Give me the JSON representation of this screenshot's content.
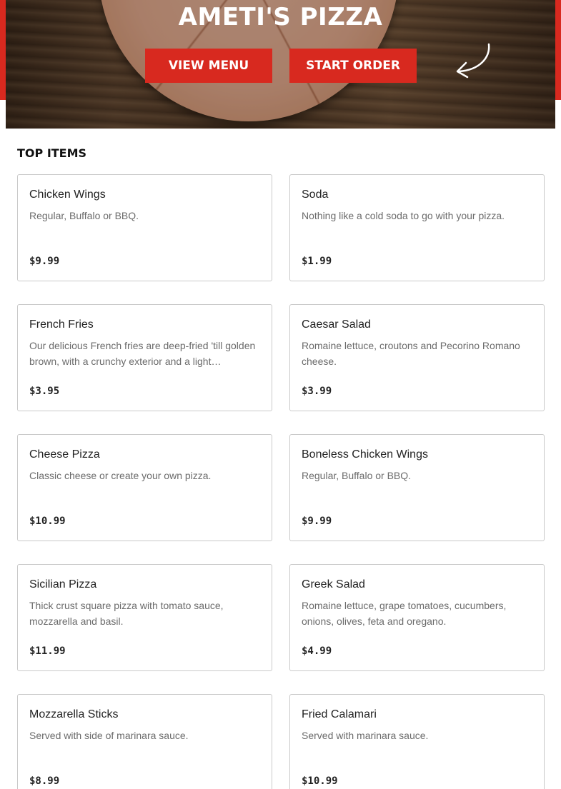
{
  "hero": {
    "title": "AMETI'S PIZZA",
    "view_menu_label": "VIEW MENU",
    "start_order_label": "START ORDER",
    "accent_color": "#d8291f"
  },
  "top_items": {
    "title": "TOP ITEMS",
    "items": [
      {
        "name": "Chicken Wings",
        "description": "Regular, Buffalo or BBQ.",
        "price": "$9.99"
      },
      {
        "name": "Soda",
        "description": "Nothing like a cold soda to go with your pizza.",
        "price": "$1.99"
      },
      {
        "name": "French Fries",
        "description": "Our delicious French fries are deep-fried 'till golden brown, with a crunchy exterior and a light…",
        "price": "$3.95"
      },
      {
        "name": "Caesar Salad",
        "description": "Romaine lettuce, croutons and Pecorino Romano cheese.",
        "price": "$3.99"
      },
      {
        "name": "Cheese Pizza",
        "description": "Classic cheese or create your own pizza.",
        "price": "$10.99"
      },
      {
        "name": "Boneless Chicken Wings",
        "description": "Regular, Buffalo or BBQ.",
        "price": "$9.99"
      },
      {
        "name": "Sicilian Pizza",
        "description": "Thick crust square pizza with tomato sauce, mozzarella and basil.",
        "price": "$11.99"
      },
      {
        "name": "Greek Salad",
        "description": "Romaine lettuce, grape tomatoes, cucumbers, onions, olives, feta and oregano.",
        "price": "$4.99"
      },
      {
        "name": "Mozzarella Sticks",
        "description": "Served with side of marinara sauce.",
        "price": "$8.99"
      },
      {
        "name": "Fried Calamari",
        "description": "Served with marinara sauce.",
        "price": "$10.99"
      }
    ]
  }
}
